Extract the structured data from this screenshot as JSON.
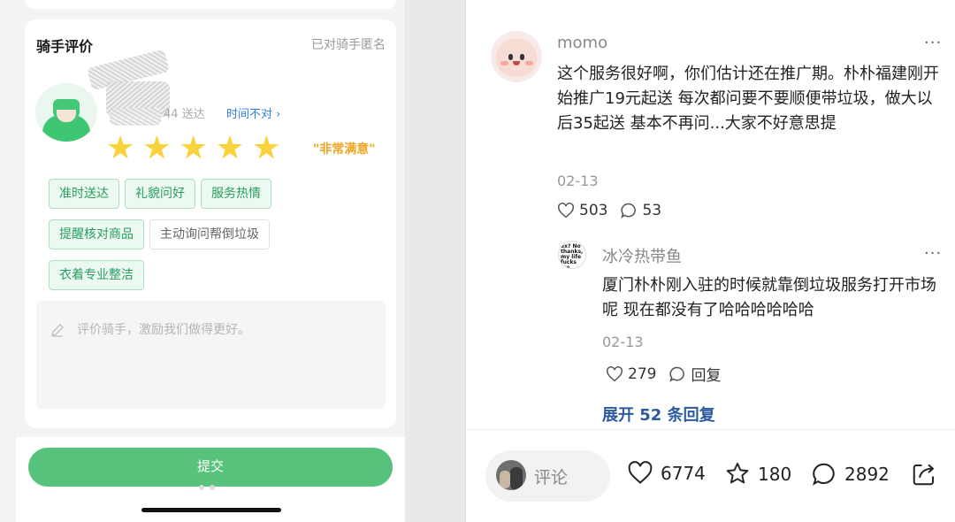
{
  "rider_review": {
    "title": "骑手评价",
    "anonymous_label": "已对骑手匿名",
    "delivered_text": "44 送达",
    "time_wrong_link": "时间不对 ›",
    "rating_stars": 5,
    "rating_text": "\"非常满意\"",
    "tags": [
      {
        "label": "准时送达",
        "selected": true
      },
      {
        "label": "礼貌问好",
        "selected": true
      },
      {
        "label": "服务热情",
        "selected": true
      },
      {
        "label": "提醒核对商品",
        "selected": true
      },
      {
        "label": "主动询问帮倒垃圾",
        "selected": false
      },
      {
        "label": "衣着专业整洁",
        "selected": true
      }
    ],
    "comment_placeholder": "评价骑手，激励我们做得更好。",
    "submit_label": "提交"
  },
  "comments": {
    "main": {
      "author": "momo",
      "more": "···",
      "content": "这个服务很好啊，你们估计还在推广期。朴朴福建刚开始推广19元起送 每次都问要不要顺便带垃圾，做大以后35起送 基本不再问...大家不好意思提",
      "date": "02-13",
      "likes": "503",
      "replies": "53"
    },
    "reply": {
      "author": "冰冷热带鱼",
      "avatar_text": "ex? No thanks, my life fucks me every day",
      "more": "···",
      "content": "厦门朴朴刚入驻的时候就靠倒垃圾服务打开市场呢 现在都没有了哈哈哈哈哈哈",
      "date": "02-13",
      "likes": "279",
      "reply_label": "回复"
    },
    "expand_label": "展开 52 条回复"
  },
  "footer": {
    "comment_placeholder": "评论",
    "likes": "6774",
    "favorites": "180",
    "comments": "2892"
  },
  "colors": {
    "accent_green": "#57c27c",
    "tag_green": "#2a9d5e",
    "star_yellow": "#f9d33b",
    "rating_orange": "#f1a521",
    "link_blue": "#2f7fe0",
    "expand_blue": "#2b5a9e"
  }
}
